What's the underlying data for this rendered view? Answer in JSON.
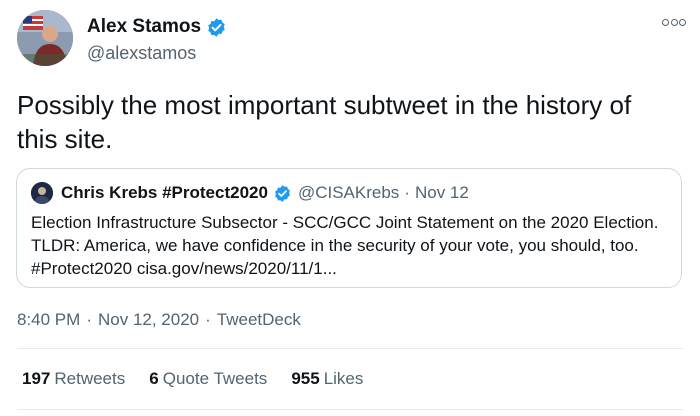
{
  "author": {
    "name": "Alex Stamos",
    "handle": "@alexstamos",
    "verified_icon": "verified-badge-icon"
  },
  "menu_icon": "more-options-icon",
  "tweet": {
    "text": "Possibly the most important subtweet in the history of this site."
  },
  "quoted": {
    "name": "Chris Krebs #Protect2020",
    "handle": "@CISAKrebs",
    "separator": "·",
    "date": "Nov 12",
    "text": "Election Infrastructure Subsector - SCC/GCC Joint Statement on the 2020 Election. TLDR: America, we have confidence in the security of your vote, you should, too. #Protect2020 cisa.gov/news/2020/11/1..."
  },
  "meta": {
    "time": "8:40 PM",
    "sep1": "·",
    "date": "Nov 12, 2020",
    "sep2": "·",
    "source": "TweetDeck"
  },
  "stats": {
    "retweets_count": "197",
    "retweets_label": "Retweets",
    "quotes_count": "6",
    "quotes_label": "Quote Tweets",
    "likes_count": "955",
    "likes_label": "Likes"
  },
  "colors": {
    "verified_blue": "#1d9bf0",
    "secondary_text": "#536471",
    "border": "#cfd9de"
  }
}
